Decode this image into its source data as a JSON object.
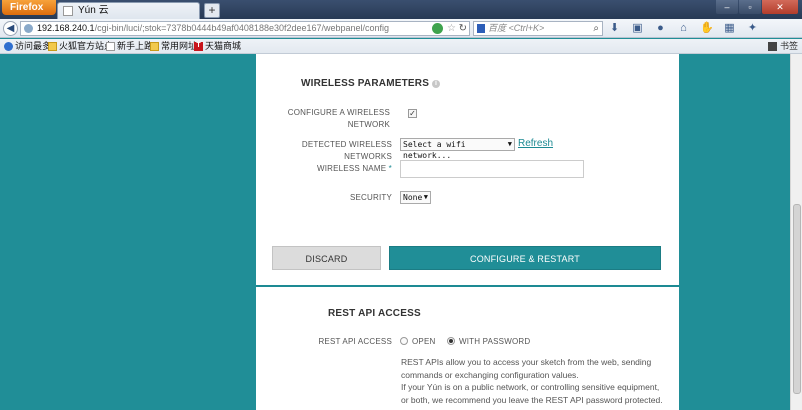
{
  "browser": {
    "menu_label": "Firefox",
    "tab_title": "Yún 云",
    "new_tab_label": "+",
    "url_host": "192.168.240.1",
    "url_path": "/cgi-bin/luci/;stok=7378b0444b49af0408188e30f2dee167/webpanel/config",
    "search_placeholder": "百度 <Ctrl+K>",
    "window_controls": [
      "–",
      "▫",
      "✕"
    ]
  },
  "bookmarks": {
    "items": [
      "访问最多",
      "火狐官方站点",
      "新手上路",
      "常用网址",
      "天猫商城"
    ],
    "right": "书签"
  },
  "wireless": {
    "title": "WIRELESS PARAMETERS",
    "configure_label": "CONFIGURE A WIRELESS NETWORK",
    "configure_checked": true,
    "detected_label": "DETECTED WIRELESS NETWORKS",
    "detected_value": "Select a wifi network...",
    "refresh_label": "Refresh",
    "name_label": "WIRELESS NAME",
    "required_mark": "*",
    "name_value": "",
    "security_label": "SECURITY",
    "security_value": "None"
  },
  "actions": {
    "discard_label": "DISCARD",
    "configure_label": "CONFIGURE & RESTART"
  },
  "rest_api": {
    "title": "REST API ACCESS",
    "access_label": "REST API ACCESS",
    "options": [
      "OPEN",
      "WITH PASSWORD"
    ],
    "selected": "WITH PASSWORD",
    "description": [
      "REST APIs allow you to access your sketch from the web, sending",
      "commands or exchanging configuration values.",
      "If your Yún is on a public network, or controlling sensitive equipment,",
      "or both, we recommend you leave the REST API password protected."
    ]
  }
}
